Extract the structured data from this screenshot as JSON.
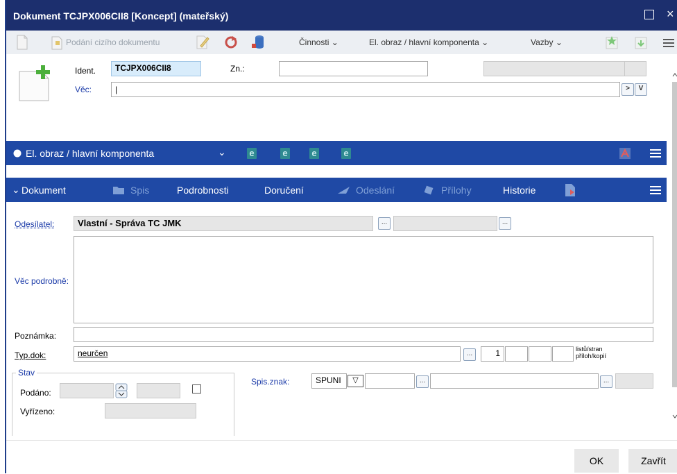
{
  "window": {
    "title": "Dokument TCJPX006CII8 [Koncept] (mateřský)",
    "maximize_icon": "maximize-icon",
    "close_glyph": "×"
  },
  "toolbar": {
    "new_doc_icon": "new-document-icon",
    "foreign_doc_label": "Podání cizího dokumentu",
    "edit_icon": "edit-icon",
    "refresh_icon": "refresh-icon",
    "save_icon": "database-icon",
    "cinnosti_label": "Činnosti",
    "el_obraz_label": "El. obraz / hlavní komponenta",
    "vazby_label": "Vazby",
    "star_icon": "star-doc-icon",
    "down_icon": "download-doc-icon",
    "menu_icon": "hamburger-icon"
  },
  "header": {
    "ident_label": "Ident.",
    "ident_value": "TCJPX006CII8",
    "zn_label": "Zn.:",
    "zn_value": "",
    "vec_label": "Věc:",
    "vec_value": "|",
    "vec_btn_more": ">",
    "vec_btn_v": "V"
  },
  "el_obraz_bar": {
    "label": "El. obraz / hlavní komponenta",
    "pdf_icon": "pdf-icon",
    "menu_icon": "hamburger-icon"
  },
  "dokument_bar": {
    "label": "Dokument",
    "tabs": [
      {
        "label": "Spis",
        "enabled": false
      },
      {
        "label": "Podrobnosti",
        "enabled": true
      },
      {
        "label": "Doručení",
        "enabled": true
      },
      {
        "label": "Odeslání",
        "enabled": false
      },
      {
        "label": "Přílohy",
        "enabled": false
      },
      {
        "label": "Historie",
        "enabled": true
      }
    ]
  },
  "form": {
    "odesilatel_label": "Odesílatel:",
    "odesilatel_value": "Vlastní - Správa TC JMK",
    "vec_podrobne_label": "Věc podrobně:",
    "poznamka_label": "Poznámka:",
    "typ_dok_label": "Typ.dok:",
    "typ_dok_value": "neurčen",
    "count_value": "1",
    "listu_label": "listů/stran",
    "priloh_label": "příloh/kopií",
    "stav_label": "Stav",
    "podano_label": "Podáno:",
    "vyrizeno_label": "Vyřízeno:",
    "spis_znak_label": "Spis.znak:",
    "spis_znak_value": "SPUNI",
    "ellipsis": "..."
  },
  "footer": {
    "ok_label": "OK",
    "close_label": "Zavřít"
  },
  "colors": {
    "titlebar": "#1c2f6e",
    "section_bar": "#1f49a5",
    "label_blue": "#1a3aa8"
  }
}
